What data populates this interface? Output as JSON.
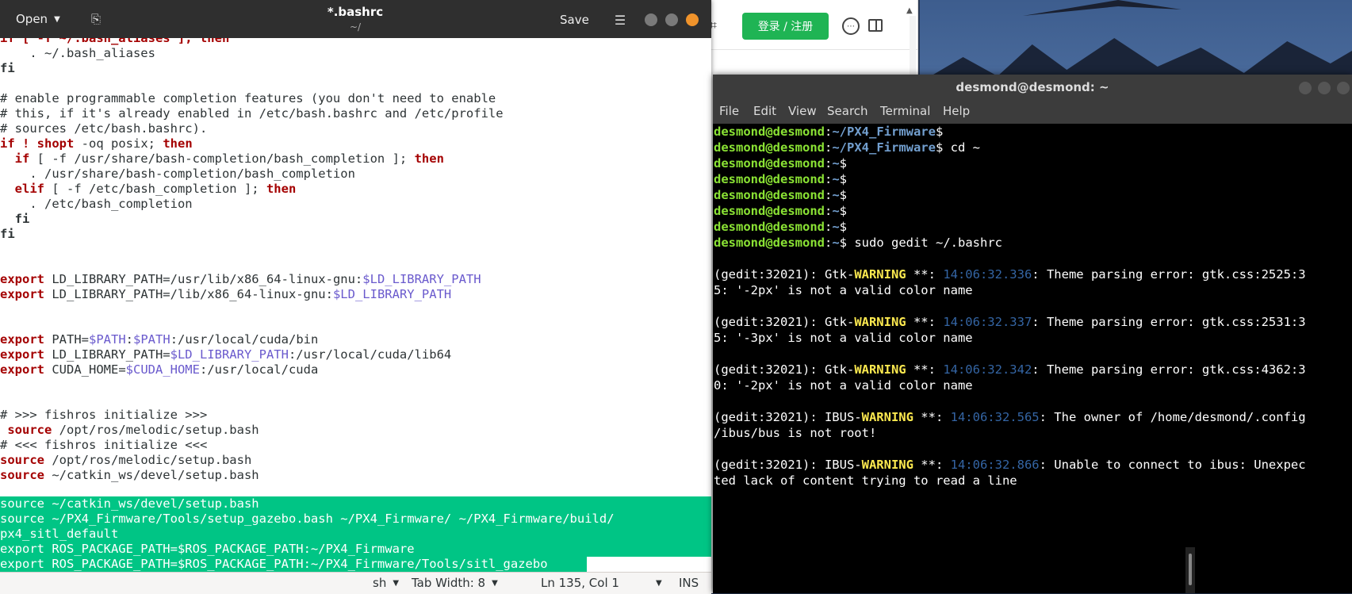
{
  "browser": {
    "login_label": "登录 / 注册",
    "backtop_icon": "arrow-up-to-line-icon"
  },
  "gedit": {
    "open_label": "Open",
    "title": "*.bashrc",
    "subtitle": "~/",
    "save_label": "Save",
    "lines": {
      "l0": "if [ -f ~/.bash_aliases ]; then",
      "l1": "    . ~/.bash_aliases",
      "l2": "fi",
      "l4": "# enable programmable completion features (you don't need to enable",
      "l5": "# this, if it's already enabled in /etc/bash.bashrc and /etc/profile",
      "l6": "# sources /etc/bash.bashrc).",
      "l7a": "if",
      "l7b": " ! ",
      "l7c": "shopt",
      "l7d": " -oq posix; ",
      "l7e": "then",
      "l8a": "  if",
      "l8b": " [ -f /usr/share/bash-completion/bash_completion ]; ",
      "l8c": "then",
      "l9": "    . /usr/share/bash-completion/bash_completion",
      "l10a": "  elif",
      "l10b": " [ -f /etc/bash_completion ]; ",
      "l10c": "then",
      "l11": "    . /etc/bash_completion",
      "l12": "  fi",
      "l13": "fi",
      "l16a": "export",
      "l16b": " LD_LIBRARY_PATH=/usr/lib/x86_64-linux-gnu:",
      "l16c": "$LD_LIBRARY_PATH",
      "l17a": "export",
      "l17b": " LD_LIBRARY_PATH=/lib/x86_64-linux-gnu:",
      "l17c": "$LD_LIBRARY_PATH",
      "l19a": "export",
      "l19b": " PATH=",
      "l19c": "$PATH",
      "l19d": ":",
      "l19e": "$PATH",
      "l19f": ":/usr/local/cuda/bin",
      "l20a": "export",
      "l20b": " LD_LIBRARY_PATH=",
      "l20c": "$LD_LIBRARY_PATH",
      "l20d": ":/usr/local/cuda/lib64",
      "l21a": "export",
      "l21b": " CUDA_HOME=",
      "l21c": "$CUDA_HOME",
      "l21d": ":/usr/local/cuda",
      "l24": "# >>> fishros initialize >>>",
      "l25a": " source",
      "l25b": " /opt/ros/melodic/setup.bash",
      "l26": "# <<< fishros initialize <<<",
      "l27a": "source",
      "l27b": " /opt/ros/melodic/setup.bash",
      "l28a": "source",
      "l28b": " ~/catkin_ws/devel/setup.bash",
      "s0": "source ~/catkin_ws/devel/setup.bash",
      "s1": "source ~/PX4_Firmware/Tools/setup_gazebo.bash ~/PX4_Firmware/ ~/PX4_Firmware/build/",
      "s2": "px4_sitl_default",
      "s3": "export ROS_PACKAGE_PATH=$ROS_PACKAGE_PATH:~/PX4_Firmware",
      "s4": "export ROS_PACKAGE_PATH=$ROS_PACKAGE_PATH:~/PX4_Firmware/Tools/sitl_gazebo"
    },
    "status": {
      "lang": "sh",
      "tab_width": "Tab Width: 8",
      "position": "Ln 135, Col 1",
      "mode": "INS"
    }
  },
  "terminal": {
    "title": "desmond@desmond: ~",
    "menu": [
      "File",
      "Edit",
      "View",
      "Search",
      "Terminal",
      "Help"
    ],
    "user": "desmond@desmond",
    "path_px4": "~/PX4_Firmware",
    "path_home": "~",
    "cmd_cd": " cd ~",
    "cmd_gedit": " sudo gedit ~/.bashrc",
    "warn_word": "WARNING",
    "w1": {
      "pre": "(gedit:32021): Gtk-",
      "mid": " **: ",
      "ts": "14:06:32.336",
      "post": ": Theme parsing error: gtk.css:2525:3",
      "cont": "5: '-2px' is not a valid color name"
    },
    "w2": {
      "pre": "(gedit:32021): Gtk-",
      "mid": " **: ",
      "ts": "14:06:32.337",
      "post": ": Theme parsing error: gtk.css:2531:3",
      "cont": "5: '-3px' is not a valid color name"
    },
    "w3": {
      "pre": "(gedit:32021): Gtk-",
      "mid": " **: ",
      "ts": "14:06:32.342",
      "post": ": Theme parsing error: gtk.css:4362:3",
      "cont": "0: '-2px' is not a valid color name"
    },
    "w4": {
      "pre": "(gedit:32021): IBUS-",
      "mid": " **: ",
      "ts": "14:06:32.565",
      "post": ": The owner of /home/desmond/.config",
      "cont": "/ibus/bus is not root!"
    },
    "w5": {
      "pre": "(gedit:32021): IBUS-",
      "mid": " **: ",
      "ts": "14:06:32.866",
      "post": ": Unable to connect to ibus: Unexpec",
      "cont": "ted lack of content trying to read a line"
    }
  }
}
